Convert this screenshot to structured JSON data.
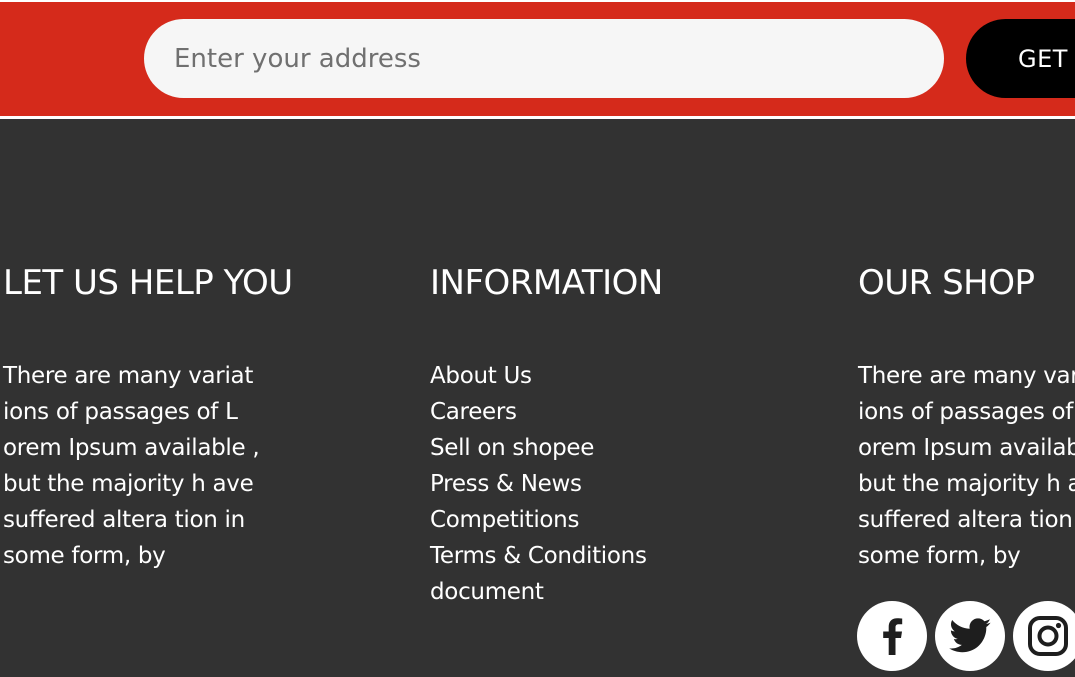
{
  "newsletter": {
    "address_placeholder": "Enter your address",
    "get_button_label": "GET",
    "band_color": "#d52a1b"
  },
  "footer": {
    "background_color": "#323232",
    "help": {
      "heading": "LET US HELP YOU",
      "text_lines": [
        "There are many variat",
        "ions of passages of L",
        "orem Ipsum available ,",
        "but the majority h ave",
        "suffered altera tion in",
        "some form, by"
      ]
    },
    "information": {
      "heading": "INFORMATION",
      "links": [
        "About Us",
        "Careers",
        "Sell on shopee",
        "Press & News",
        "Competitions",
        "Terms & Conditions",
        "document"
      ]
    },
    "shop": {
      "heading": "OUR SHOP",
      "text_lines": [
        "There are many variat",
        "ions of passages of L",
        "orem Ipsum available ,",
        "but the majority h ave",
        "suffered altera tion in",
        "some form, by"
      ],
      "social_icons": [
        "facebook-icon",
        "twitter-icon",
        "instagram-icon"
      ]
    }
  }
}
